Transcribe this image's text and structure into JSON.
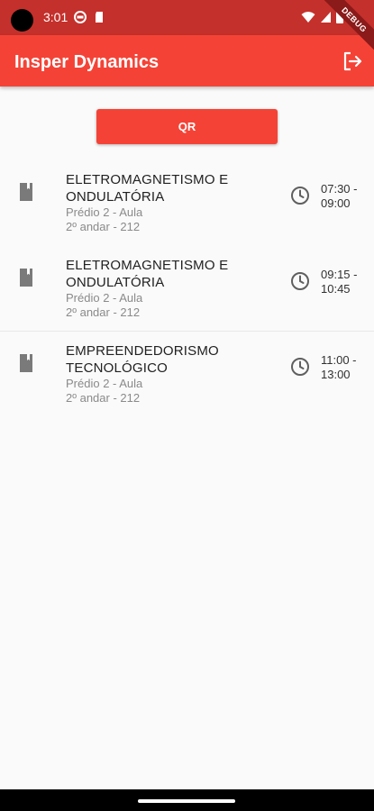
{
  "status_bar": {
    "time": "3:01",
    "icons": [
      "camera-cutout",
      "notification-icon",
      "sd-card-icon",
      "wifi-icon",
      "signal-icon",
      "battery-icon"
    ]
  },
  "debug_banner": "DEBUG",
  "app_bar": {
    "title": "Insper Dynamics",
    "action_icon": "logout-icon",
    "background": "#f44336"
  },
  "qr_button": {
    "label": "QR"
  },
  "classes": [
    {
      "title": "ELETROMAGNETISMO E ONDULATÓRIA",
      "location_line1": "Prédio 2 - Aula",
      "location_line2": "2º andar - 212",
      "time": "07:30 - 09:00",
      "icon": "book-icon"
    },
    {
      "title": "ELETROMAGNETISMO E ONDULATÓRIA",
      "location_line1": "Prédio 2 - Aula",
      "location_line2": "2º andar - 212",
      "time": "09:15 - 10:45",
      "icon": "book-icon"
    },
    {
      "title": "EMPREENDEDORISMO TECNOLÓGICO",
      "location_line1": "Prédio 2 - Aula",
      "location_line2": "2º andar - 212",
      "time": "11:00 - 13:00",
      "icon": "book-icon"
    }
  ]
}
